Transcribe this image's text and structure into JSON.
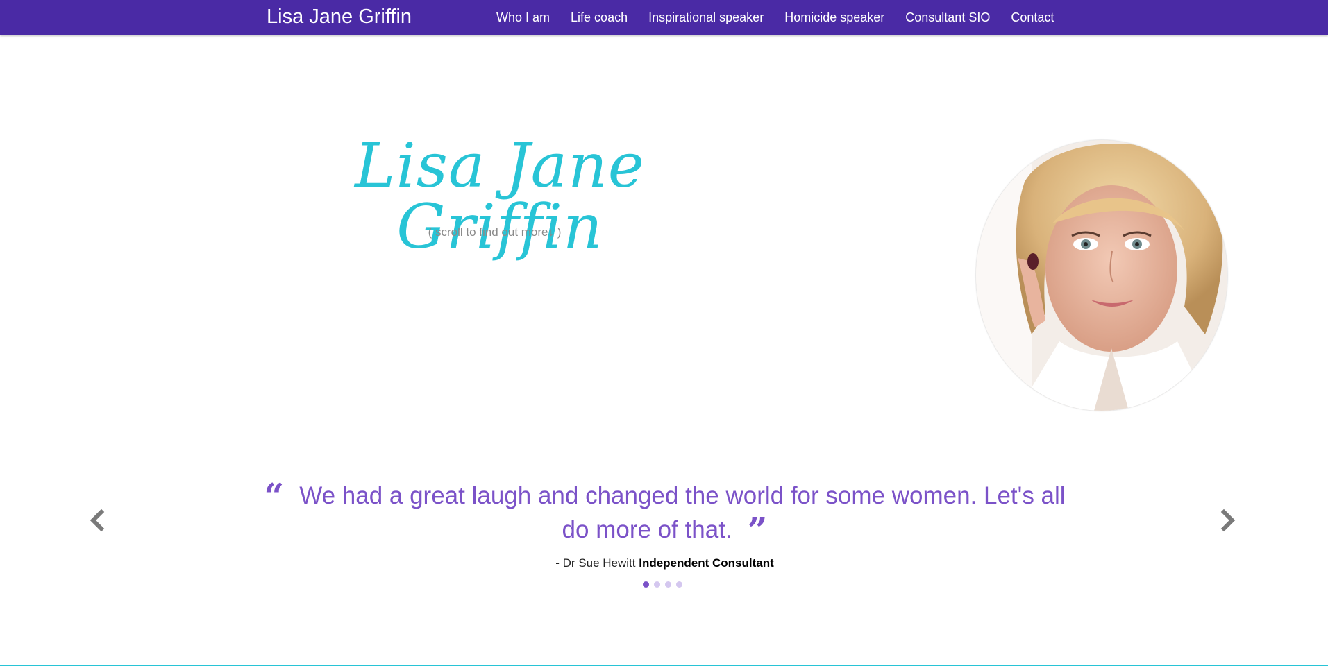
{
  "navbar": {
    "brand": "Lisa Jane Griffin",
    "links": [
      {
        "label": "Who I am"
      },
      {
        "label": "Life coach"
      },
      {
        "label": "Inspirational speaker"
      },
      {
        "label": "Homicide speaker"
      },
      {
        "label": "Consultant SIO"
      },
      {
        "label": "Contact"
      }
    ]
  },
  "hero": {
    "title": "Lisa Jane Griffin",
    "subtitle": "( scroll to find out more↓ )"
  },
  "testimonial": {
    "quote": "We had a great laugh and changed the world for some women. Let's all do more of that.",
    "author": "- Dr Sue Hewitt",
    "role": "Independent Consultant",
    "slide_count": 4,
    "active_slide": 1
  },
  "colors": {
    "navbar_bg": "#4a2aa5",
    "title_color": "#28c4d6",
    "quote_color": "#7b52c8"
  }
}
